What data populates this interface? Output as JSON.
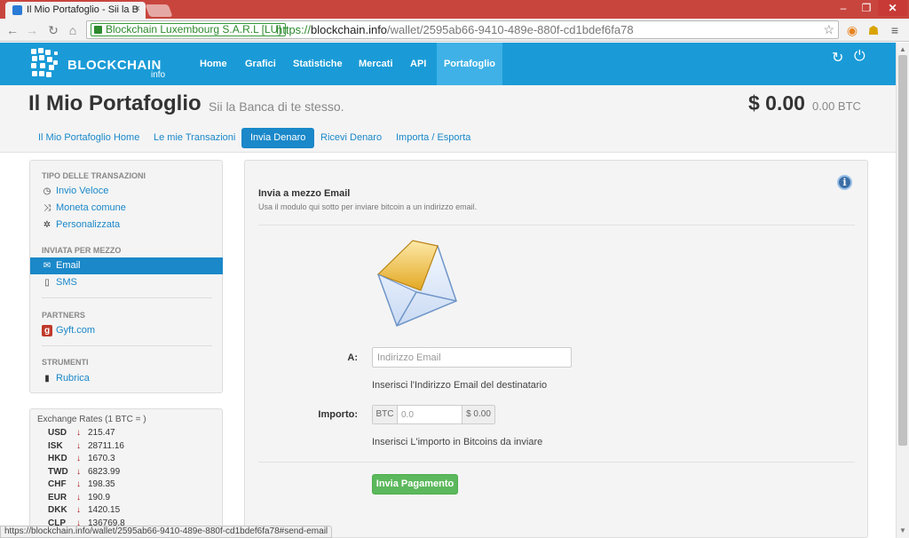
{
  "browser": {
    "tab_title": "Il Mio Portafoglio - Sii la B",
    "tab_close": "×",
    "window_controls": {
      "minimize": "–",
      "maximize": "❐",
      "close": "✕"
    },
    "ev_badge": "Blockchain Luxembourg S.A.R.L [LU]",
    "url_scheme": "https://",
    "url_host": "blockchain.info",
    "url_path": "/wallet/2595ab66-9410-489e-880f-cd1bdef6fa78",
    "status_url": "https://blockchain.info/wallet/2595ab66-9410-489e-880f-cd1bdef6fa78#send-email"
  },
  "site": {
    "brand": "BLOCKCHAIN",
    "brand_sub": "info",
    "brand_color": "#1a9bd7",
    "nav": [
      "Home",
      "Grafici",
      "Statistiche",
      "Mercati",
      "API",
      "Portafoglio"
    ],
    "nav_active": "Portafoglio"
  },
  "header": {
    "title": "Il Mio Portafoglio",
    "subtitle": "Sii la Banca di te stesso.",
    "balance_usd": "$ 0.00",
    "balance_btc": "0.00 BTC"
  },
  "subtabs": [
    "Il Mio Portafoglio Home",
    "Le mie Transazioni",
    "Invia Denaro",
    "Ricevi Denaro",
    "Importa / Esporta"
  ],
  "subtab_active": "Invia Denaro",
  "sidebar": {
    "sections": [
      {
        "heading": "TIPO DELLE TRANSAZIONI",
        "items": [
          {
            "label": "Invio Veloce",
            "icon": "clock-icon"
          },
          {
            "label": "Moneta comune",
            "icon": "shuffle-icon"
          },
          {
            "label": "Personalizzata",
            "icon": "gear-icon"
          }
        ]
      },
      {
        "heading": "INVIATA PER MEZZO",
        "items": [
          {
            "label": "Email",
            "icon": "envelope-icon",
            "active": true
          },
          {
            "label": "SMS",
            "icon": "phone-icon"
          }
        ]
      },
      {
        "heading": "PARTNERS",
        "items": [
          {
            "label": "Gyft.com",
            "icon": "gyft-icon"
          }
        ]
      },
      {
        "heading": "STRUMENTI",
        "items": [
          {
            "label": "Rubrica",
            "icon": "book-icon"
          }
        ]
      }
    ]
  },
  "rates": {
    "title": "Exchange Rates (1 BTC = )",
    "rows": [
      {
        "cur": "USD",
        "val": "215.47"
      },
      {
        "cur": "ISK",
        "val": "28711.16"
      },
      {
        "cur": "HKD",
        "val": "1670.3"
      },
      {
        "cur": "TWD",
        "val": "6823.99"
      },
      {
        "cur": "CHF",
        "val": "198.35"
      },
      {
        "cur": "EUR",
        "val": "190.9"
      },
      {
        "cur": "DKK",
        "val": "1420.15"
      },
      {
        "cur": "CLP",
        "val": "136769.8"
      }
    ]
  },
  "form": {
    "title": "Invia a mezzo Email",
    "description": "Usa il modulo qui sotto per inviare bitcoin a un indirizzo email.",
    "to_label": "A:",
    "email_placeholder": "Indirizzo Email",
    "email_help": "Inserisci l'Indirizzo Email del destinatario",
    "amount_label": "Importo:",
    "btc_addon": "BTC",
    "amount_placeholder": "0.0",
    "usd_addon": "$ 0.00",
    "amount_help": "Inserisci L'importo in Bitcoins da inviare",
    "submit": "Invia Pagamento"
  }
}
